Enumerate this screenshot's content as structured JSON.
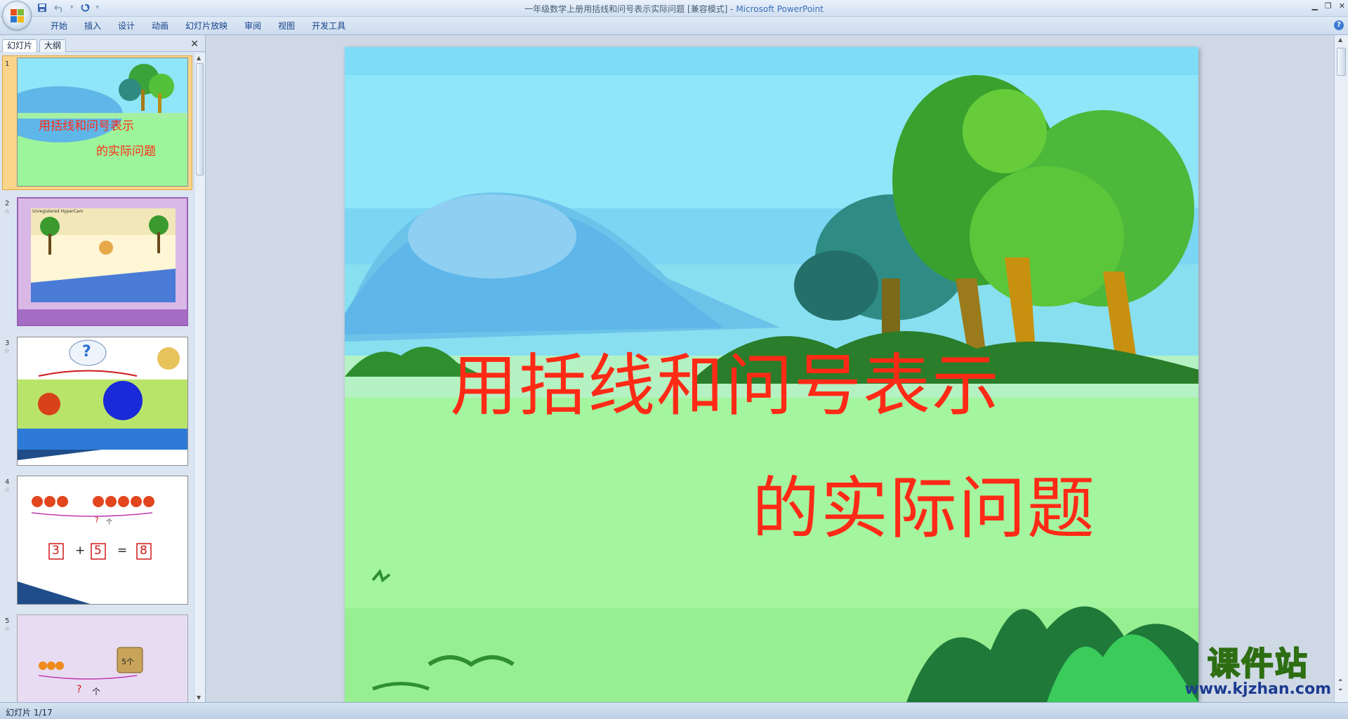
{
  "window": {
    "title": "一年级数学上册用括线和问号表示实际问题 [兼容模式] - ",
    "app_name": "Microsoft PowerPoint"
  },
  "quick_access": {
    "icons": [
      "save-icon",
      "undo-icon",
      "redo-icon",
      "customize-icon"
    ]
  },
  "ribbon": {
    "tabs": [
      "开始",
      "插入",
      "设计",
      "动画",
      "幻灯片放映",
      "审阅",
      "视图",
      "开发工具"
    ]
  },
  "left_pane": {
    "tab_slides": "幻灯片",
    "tab_outline": "大纲",
    "close_glyph": "✕",
    "thumbnails": [
      {
        "number": "1",
        "title_line1": "用括线和问号表示",
        "title_line2": "的实际问题"
      },
      {
        "number": "2",
        "caption": "Unregistered HyperCam"
      },
      {
        "number": "3",
        "symbol": "?"
      },
      {
        "number": "4",
        "question": "?",
        "unit": "个",
        "eq_a": "3",
        "op": "+",
        "eq_b": "5",
        "eq": "=",
        "eq_c": "8"
      },
      {
        "number": "5",
        "question": "?",
        "unit": "个",
        "basket_label": "5个"
      }
    ]
  },
  "slide": {
    "title_line1": "用括线和问号表示",
    "title_line2": "的实际问题"
  },
  "watermark": {
    "cn": "课件站",
    "url": "www.kjzhan.com"
  },
  "status": {
    "text": "幻灯片 1/17"
  },
  "colors": {
    "title_red": "#ff2a16",
    "sky": "#8ee6f8",
    "grass": "#9cf59b",
    "ribbon_blue": "#15428b"
  }
}
